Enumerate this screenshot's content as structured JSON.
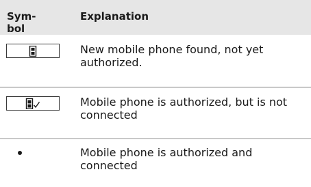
{
  "table": {
    "header": {
      "symbol_line1": "Sym-",
      "symbol_line2": "bol",
      "explanation": "Explanation"
    },
    "rows": [
      {
        "icon": "phone-icon",
        "explanation": "New mobile phone found, not yet authorized."
      },
      {
        "icon": "phone-authorized-icon",
        "explanation": "Mobile phone is authorized, but is not connected"
      },
      {
        "icon": "bullet-icon",
        "explanation": "Mobile phone is authorized and connected"
      }
    ]
  },
  "colors": {
    "header_background": "#e6e6e6",
    "row_divider": "#c9c9c9",
    "text": "#1a1a1a"
  }
}
